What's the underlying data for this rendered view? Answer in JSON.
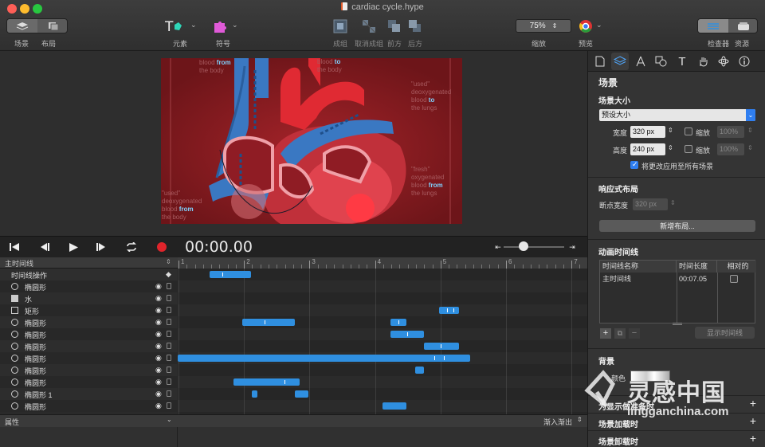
{
  "window": {
    "title": "cardiac cycle.hype"
  },
  "toolbar": {
    "scene_label": "场景",
    "layout_label": "布局",
    "elements_label": "元素",
    "symbols_label": "符号",
    "group_label": "成组",
    "ungroup_label": "取消成组",
    "forward_label": "前方",
    "backward_label": "后方",
    "zoom_value": "75%",
    "zoom_label": "缩放",
    "preview_label": "预览",
    "inspector_label": "检查器",
    "resources_label": "资源"
  },
  "stage": {
    "texts": [
      {
        "pre": "blood ",
        "bold": "from",
        "post": "the body"
      },
      {
        "pre": "blood ",
        "bold": "to",
        "post": "the body"
      },
      {
        "pre": "\"used\" deoxygenated blood ",
        "bold": "to",
        "post": "the lungs"
      },
      {
        "pre": "\"fresh\" oxygenated blood ",
        "bold": "from",
        "post": "the lungs"
      },
      {
        "pre": "\"used\" deoxygenated blood ",
        "bold": "from",
        "post": "the body"
      }
    ]
  },
  "playback": {
    "timecode": "00:00.00"
  },
  "timeline": {
    "main_label": "主时间线",
    "ruler_numbers": [
      "1",
      "2",
      "3",
      "4",
      "5",
      "6",
      "7"
    ],
    "actions_label": "时间线操作",
    "layers": [
      {
        "name": "椭圆形",
        "shape": "circle"
      },
      {
        "name": "水",
        "shape": "image"
      },
      {
        "name": "矩形",
        "shape": "rect"
      },
      {
        "name": "椭圆形",
        "shape": "circle"
      },
      {
        "name": "椭圆形",
        "shape": "circle"
      },
      {
        "name": "椭圆形",
        "shape": "circle"
      },
      {
        "name": "椭圆形",
        "shape": "circle"
      },
      {
        "name": "椭圆形",
        "shape": "circle"
      },
      {
        "name": "椭圆形",
        "shape": "circle"
      },
      {
        "name": "椭圆形 1",
        "shape": "circle"
      },
      {
        "name": "椭圆形",
        "shape": "circle"
      }
    ],
    "properties_label": "属性",
    "easing_label": "渐入渐出"
  },
  "inspector": {
    "title": "场景",
    "scene_size_label": "场景大小",
    "preset_label": "预设大小",
    "width_label": "宽度",
    "width_value": "320 px",
    "height_label": "高度",
    "height_value": "240 px",
    "scale_label": "缩放",
    "scale_value_w": "100%",
    "scale_value_h": "100%",
    "apply_all_label": "将更改应用至所有场景",
    "responsive_label": "响应式布局",
    "breakpoint_label": "断点宽度",
    "breakpoint_value": "320 px",
    "new_layout_button": "新增布局...",
    "anim_timelines_label": "动画时间线",
    "col_name": "时间线名称",
    "col_duration": "时间长度",
    "col_relative": "相对的",
    "row_name": "主时间线",
    "row_duration": "00:07.05",
    "show_timeline_button": "显示时间线",
    "background_label": "背景",
    "color_label": "颜色",
    "show_guides_label": "为显示做准备时",
    "scene_load_label": "场景加载时",
    "scene_unload_label": "场景卸载时"
  },
  "watermark": {
    "brand": "灵感中国",
    "url": "lingganchina.com"
  },
  "colors": {
    "accent": "#2f8fe0",
    "record": "#e0242b",
    "stage_bg": "#7a1a1f"
  }
}
